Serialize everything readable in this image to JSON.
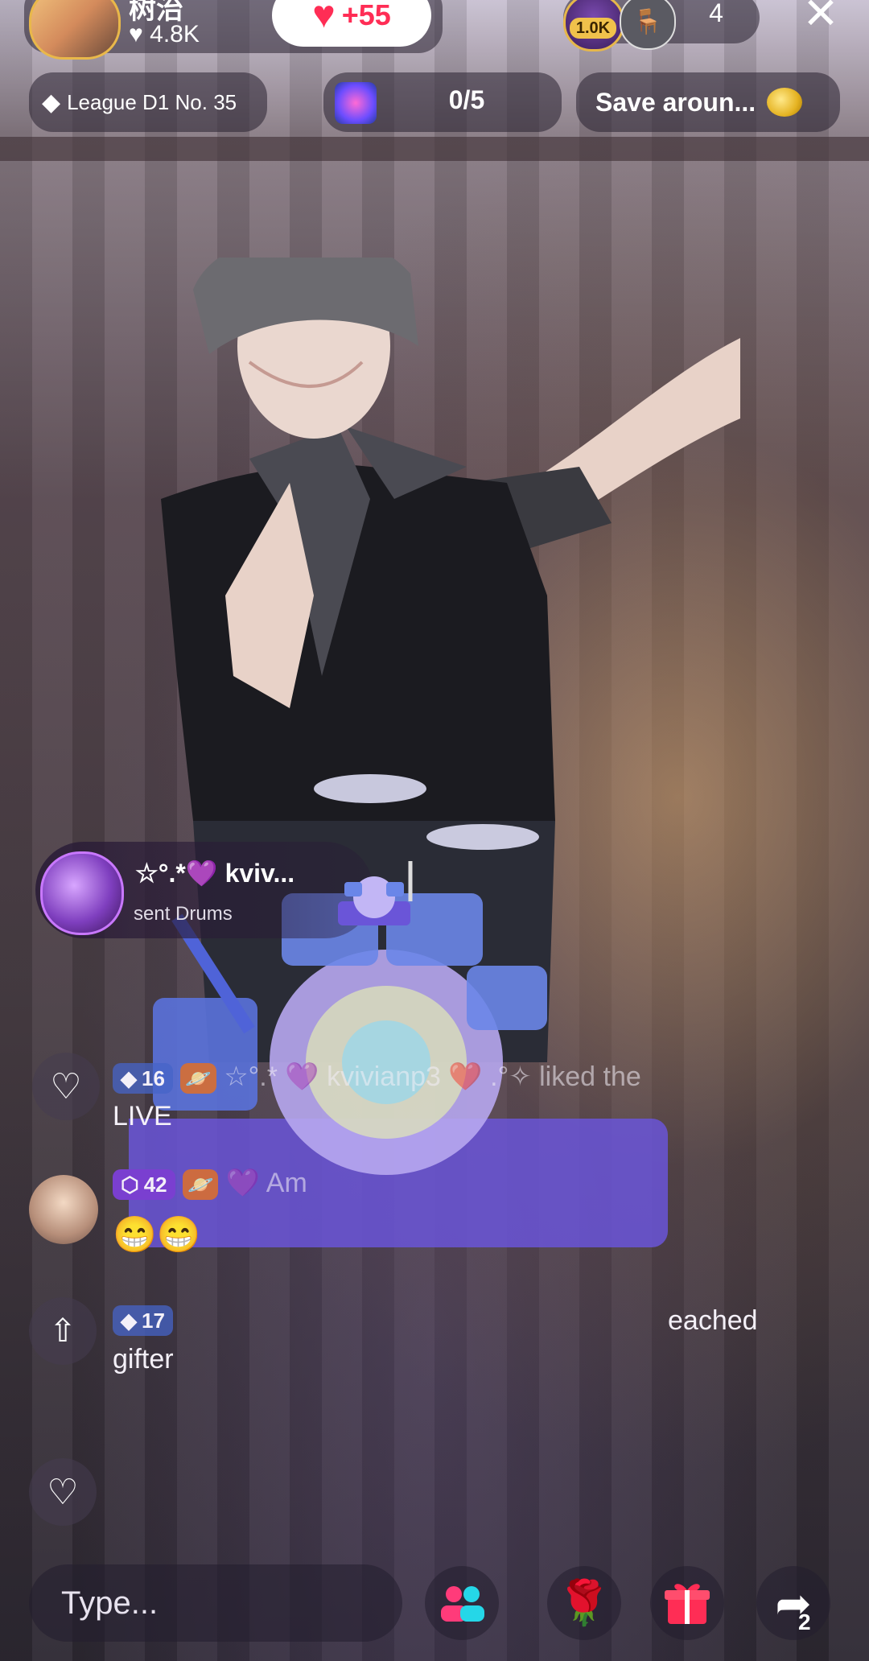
{
  "host": {
    "name": "树治",
    "likes": "4.8K"
  },
  "like_button": {
    "count": "+55"
  },
  "viewers": {
    "top_badge": "1.0K",
    "count": "4"
  },
  "league": {
    "label": "League D1 No. 35"
  },
  "goal": {
    "progress": "0/5"
  },
  "save_banner": {
    "label": "Save aroun..."
  },
  "gift_notice": {
    "user": "☆°.*💜 kviv...",
    "action": "sent Drums"
  },
  "chat": [
    {
      "level": "16",
      "text": "☆°.* 💜 kvivianp3 ❤️ .°✧ liked the",
      "text2": "LIVE"
    },
    {
      "level": "42",
      "text": "💜 Am",
      "emoji": "😁😁"
    },
    {
      "level": "17",
      "text": "",
      "text2": "gifter",
      "tail": "eached"
    }
  ],
  "bottom": {
    "placeholder": "Type...",
    "share_count": "2"
  },
  "colors": {
    "like": "#ff2d55",
    "gift": "#ff2d55",
    "accent": "#f0c14b"
  }
}
